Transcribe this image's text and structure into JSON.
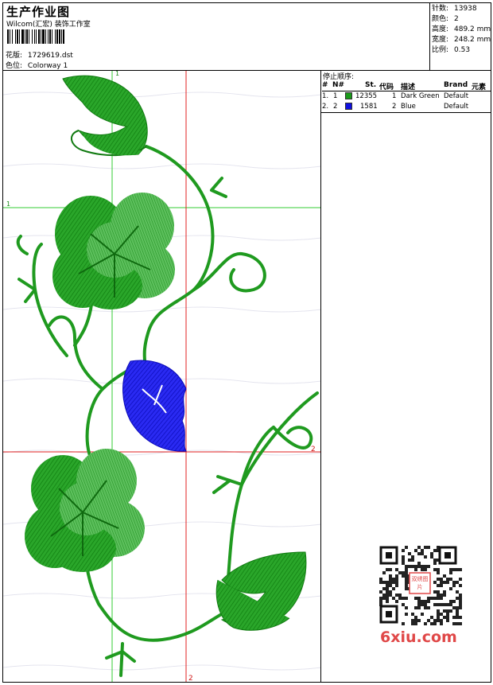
{
  "header": {
    "title": "生产作业图",
    "subtitle": "Wilcom(汇宏) 装饰工作室",
    "design_label": "花版:",
    "design_value": "1729619.dst",
    "colorway_label": "色位:",
    "colorway_value": "Colorway 1"
  },
  "stats": [
    {
      "label": "针数:",
      "value": "13938"
    },
    {
      "label": "颜色:",
      "value": "2"
    },
    {
      "label": "高度:",
      "value": "489.2 mm"
    },
    {
      "label": "宽度:",
      "value": "248.2 mm"
    },
    {
      "label": "比例:",
      "value": "0.53"
    }
  ],
  "stop_sequence": {
    "title": "停止顺序:",
    "columns": [
      "#",
      "N#",
      "St.",
      "代码",
      "描述",
      "Brand",
      "元素"
    ],
    "rows": [
      {
        "idx": "1.",
        "n": "1",
        "color": "#1a9a1a",
        "st": "12355",
        "code": "1",
        "desc": "Dark Green",
        "brand": "Default"
      },
      {
        "idx": "2.",
        "n": "2",
        "color": "#1010e0",
        "st": "1581",
        "code": "2",
        "desc": "Blue",
        "brand": "Default"
      }
    ]
  },
  "guides": {
    "h1_label": "1",
    "v1_label": "1",
    "h2_label": "2",
    "v2_label": "2"
  },
  "colors": {
    "green": "#1f9a1f",
    "green_dark": "#117a11",
    "blue": "#1515e6",
    "guide_green": "#33cc33",
    "guide_red": "#e02020"
  },
  "watermark": {
    "text": "6xiu.com",
    "qr_center": "双绣图片"
  }
}
